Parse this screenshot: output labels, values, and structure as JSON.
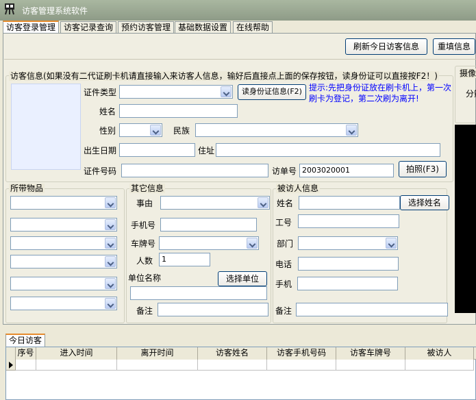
{
  "window": {
    "title": "访客管理系统软件"
  },
  "tabs": [
    {
      "label": "访客登录管理"
    },
    {
      "label": "访客记录查询"
    },
    {
      "label": "预约访客管理"
    },
    {
      "label": "基础数据设置"
    },
    {
      "label": "在线帮助"
    }
  ],
  "toolbar": {
    "refresh_label": "刷新今日访客信息",
    "reset_label": "重填信息"
  },
  "visitor": {
    "legend": "访客信息(如果没有二代证刷卡机请直接输入来访客人信息，输好后直接点上面的保存按钮，读身份证可以直接按F2！)",
    "id_type_label": "证件类型",
    "read_id_button": "读身份证信息(F2)",
    "tip": "提示:先把身份证放在刷卡机上，第一次刷卡为登记，第二次刷为离开!",
    "name_label": "姓名",
    "gender_label": "性别",
    "ethnicity_label": "民族",
    "birth_label": "出生日期",
    "address_label": "住址",
    "id_number_label": "证件号码",
    "visit_no_label": "访单号",
    "visit_no_value": "2003020001",
    "photo_button": "拍照(F3)"
  },
  "camera": {
    "label": "摄像",
    "sub_label": "分辨"
  },
  "items": {
    "legend": "所带物品"
  },
  "other": {
    "legend": "其它信息",
    "reason_label": "事由",
    "phone_label": "手机号",
    "plate_label": "车牌号",
    "count_label": "人数",
    "count_value": "1",
    "unit_label": "单位名称",
    "select_unit_button": "选择单位",
    "note_label": "备注"
  },
  "visitee": {
    "legend": "被访人信息",
    "name_label": "姓名",
    "select_name_button": "选择姓名",
    "job_no_label": "工号",
    "dept_label": "部门",
    "phone_label": "电话",
    "mobile_label": "手机",
    "note_label": "备注"
  },
  "today": {
    "tab_label": "今日访客",
    "columns": [
      "序号",
      "进入时间",
      "离开时间",
      "访客姓名",
      "访客手机号码",
      "访客车牌号",
      "被访人"
    ]
  }
}
